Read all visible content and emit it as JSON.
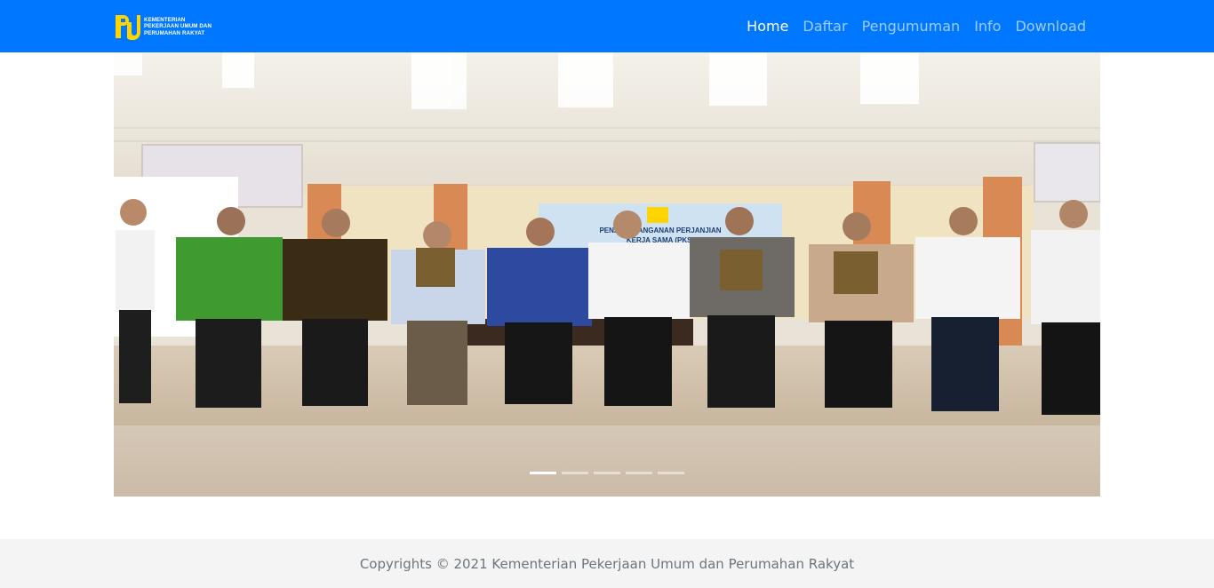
{
  "brand": {
    "lines": [
      "KEMENTERIAN",
      "PEKERJAAN UMUM DAN",
      "PERUMAHAN RAKYAT"
    ],
    "logo_icon": "pu-logo-icon"
  },
  "nav": {
    "items": [
      {
        "label": "Home",
        "active": true
      },
      {
        "label": "Daftar",
        "active": false
      },
      {
        "label": "Pengumuman",
        "active": false
      },
      {
        "label": "Info",
        "active": false
      },
      {
        "label": "Download",
        "active": false
      }
    ]
  },
  "carousel": {
    "slide_count": 5,
    "active_index": 0,
    "banner_text": [
      "PENANDATANGANAN PERJANJIAN",
      "KERJA SAMA (PKS)"
    ]
  },
  "footer": {
    "copyright": "Copyrights © 2021 Kementerian Pekerjaan Umum dan Perumahan Rakyat"
  },
  "colors": {
    "navbar": "#0077ff",
    "footer_bg": "#f4f4f4",
    "footer_text": "#6c757d"
  }
}
